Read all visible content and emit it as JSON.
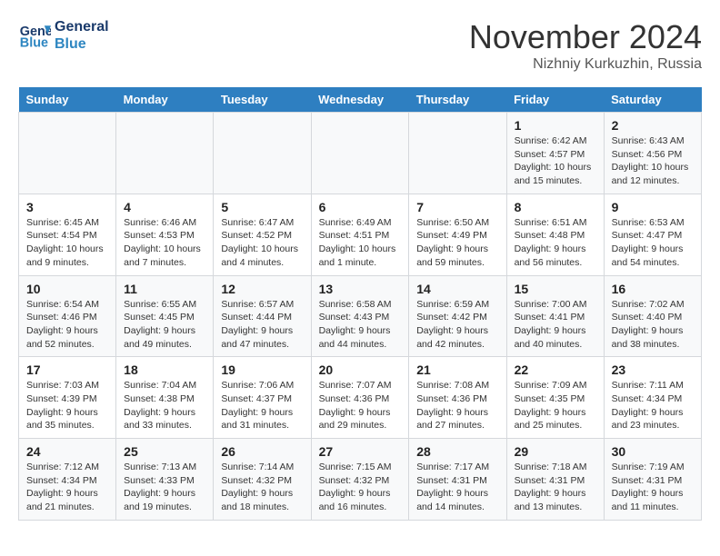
{
  "header": {
    "logo_line1": "General",
    "logo_line2": "Blue",
    "month_year": "November 2024",
    "location": "Nizhniy Kurkuzhin, Russia"
  },
  "weekdays": [
    "Sunday",
    "Monday",
    "Tuesday",
    "Wednesday",
    "Thursday",
    "Friday",
    "Saturday"
  ],
  "weeks": [
    [
      {
        "day": "",
        "info": ""
      },
      {
        "day": "",
        "info": ""
      },
      {
        "day": "",
        "info": ""
      },
      {
        "day": "",
        "info": ""
      },
      {
        "day": "",
        "info": ""
      },
      {
        "day": "1",
        "info": "Sunrise: 6:42 AM\nSunset: 4:57 PM\nDaylight: 10 hours and 15 minutes."
      },
      {
        "day": "2",
        "info": "Sunrise: 6:43 AM\nSunset: 4:56 PM\nDaylight: 10 hours and 12 minutes."
      }
    ],
    [
      {
        "day": "3",
        "info": "Sunrise: 6:45 AM\nSunset: 4:54 PM\nDaylight: 10 hours and 9 minutes."
      },
      {
        "day": "4",
        "info": "Sunrise: 6:46 AM\nSunset: 4:53 PM\nDaylight: 10 hours and 7 minutes."
      },
      {
        "day": "5",
        "info": "Sunrise: 6:47 AM\nSunset: 4:52 PM\nDaylight: 10 hours and 4 minutes."
      },
      {
        "day": "6",
        "info": "Sunrise: 6:49 AM\nSunset: 4:51 PM\nDaylight: 10 hours and 1 minute."
      },
      {
        "day": "7",
        "info": "Sunrise: 6:50 AM\nSunset: 4:49 PM\nDaylight: 9 hours and 59 minutes."
      },
      {
        "day": "8",
        "info": "Sunrise: 6:51 AM\nSunset: 4:48 PM\nDaylight: 9 hours and 56 minutes."
      },
      {
        "day": "9",
        "info": "Sunrise: 6:53 AM\nSunset: 4:47 PM\nDaylight: 9 hours and 54 minutes."
      }
    ],
    [
      {
        "day": "10",
        "info": "Sunrise: 6:54 AM\nSunset: 4:46 PM\nDaylight: 9 hours and 52 minutes."
      },
      {
        "day": "11",
        "info": "Sunrise: 6:55 AM\nSunset: 4:45 PM\nDaylight: 9 hours and 49 minutes."
      },
      {
        "day": "12",
        "info": "Sunrise: 6:57 AM\nSunset: 4:44 PM\nDaylight: 9 hours and 47 minutes."
      },
      {
        "day": "13",
        "info": "Sunrise: 6:58 AM\nSunset: 4:43 PM\nDaylight: 9 hours and 44 minutes."
      },
      {
        "day": "14",
        "info": "Sunrise: 6:59 AM\nSunset: 4:42 PM\nDaylight: 9 hours and 42 minutes."
      },
      {
        "day": "15",
        "info": "Sunrise: 7:00 AM\nSunset: 4:41 PM\nDaylight: 9 hours and 40 minutes."
      },
      {
        "day": "16",
        "info": "Sunrise: 7:02 AM\nSunset: 4:40 PM\nDaylight: 9 hours and 38 minutes."
      }
    ],
    [
      {
        "day": "17",
        "info": "Sunrise: 7:03 AM\nSunset: 4:39 PM\nDaylight: 9 hours and 35 minutes."
      },
      {
        "day": "18",
        "info": "Sunrise: 7:04 AM\nSunset: 4:38 PM\nDaylight: 9 hours and 33 minutes."
      },
      {
        "day": "19",
        "info": "Sunrise: 7:06 AM\nSunset: 4:37 PM\nDaylight: 9 hours and 31 minutes."
      },
      {
        "day": "20",
        "info": "Sunrise: 7:07 AM\nSunset: 4:36 PM\nDaylight: 9 hours and 29 minutes."
      },
      {
        "day": "21",
        "info": "Sunrise: 7:08 AM\nSunset: 4:36 PM\nDaylight: 9 hours and 27 minutes."
      },
      {
        "day": "22",
        "info": "Sunrise: 7:09 AM\nSunset: 4:35 PM\nDaylight: 9 hours and 25 minutes."
      },
      {
        "day": "23",
        "info": "Sunrise: 7:11 AM\nSunset: 4:34 PM\nDaylight: 9 hours and 23 minutes."
      }
    ],
    [
      {
        "day": "24",
        "info": "Sunrise: 7:12 AM\nSunset: 4:34 PM\nDaylight: 9 hours and 21 minutes."
      },
      {
        "day": "25",
        "info": "Sunrise: 7:13 AM\nSunset: 4:33 PM\nDaylight: 9 hours and 19 minutes."
      },
      {
        "day": "26",
        "info": "Sunrise: 7:14 AM\nSunset: 4:32 PM\nDaylight: 9 hours and 18 minutes."
      },
      {
        "day": "27",
        "info": "Sunrise: 7:15 AM\nSunset: 4:32 PM\nDaylight: 9 hours and 16 minutes."
      },
      {
        "day": "28",
        "info": "Sunrise: 7:17 AM\nSunset: 4:31 PM\nDaylight: 9 hours and 14 minutes."
      },
      {
        "day": "29",
        "info": "Sunrise: 7:18 AM\nSunset: 4:31 PM\nDaylight: 9 hours and 13 minutes."
      },
      {
        "day": "30",
        "info": "Sunrise: 7:19 AM\nSunset: 4:31 PM\nDaylight: 9 hours and 11 minutes."
      }
    ]
  ]
}
